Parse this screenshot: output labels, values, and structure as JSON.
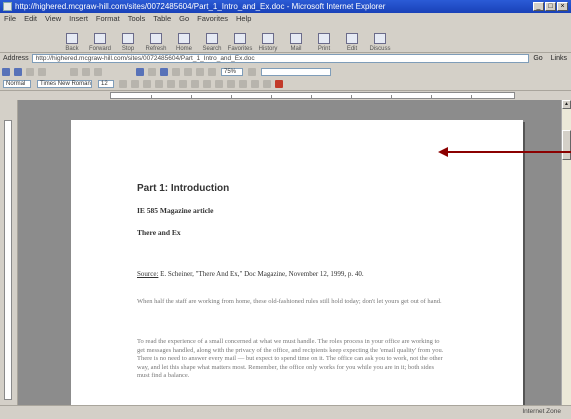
{
  "titlebar": {
    "title": "http://highered.mcgraw-hill.com/sites/0072485604/Part_1_Intro_and_Ex.doc - Microsoft Internet Explorer",
    "min": "_",
    "max": "□",
    "close": "×"
  },
  "menu": [
    "File",
    "Edit",
    "View",
    "Insert",
    "Format",
    "Tools",
    "Table",
    "Go",
    "Favorites",
    "Help"
  ],
  "toolbar": [
    {
      "label": "Back",
      "icon": "back-icon"
    },
    {
      "label": "Forward",
      "icon": "forward-icon"
    },
    {
      "label": "Stop",
      "icon": "stop-icon"
    },
    {
      "label": "Refresh",
      "icon": "refresh-icon"
    },
    {
      "label": "Home",
      "icon": "home-icon"
    },
    {
      "label": "Search",
      "icon": "search-icon"
    },
    {
      "label": "Favorites",
      "icon": "favorites-icon"
    },
    {
      "label": "History",
      "icon": "history-icon"
    },
    {
      "label": "Mail",
      "icon": "mail-icon"
    },
    {
      "label": "Print",
      "icon": "print-icon"
    },
    {
      "label": "Edit",
      "icon": "edit-icon"
    },
    {
      "label": "Discuss",
      "icon": "discuss-icon"
    }
  ],
  "address": {
    "label": "Address",
    "value": "http://highered.mcgraw-hill.com/sites/0072485604/Part_1_Intro_and_Ex.doc",
    "go": "Go",
    "links": "Links"
  },
  "format": {
    "style": "Normal",
    "font": "Times New Roman",
    "size": "12",
    "zoom": "75%"
  },
  "status": {
    "left": "",
    "right": "Internet Zone"
  },
  "document": {
    "title": "Part 1: Introduction",
    "subtitle1": "IE 585 Magazine article",
    "subtitle2": "There and Ex",
    "source_label": "Source:",
    "source_text": "E. Scheiner, \"There And Ex,\" Doc Magazine, November 12, 1999, p. 40.",
    "para1": "When half the staff are working from home, these old-fashioned rules still hold today; don't let yours get out of hand.",
    "para2": "To read the experience of a small concerned at what we must handle. The roles process in your office are working to get messages handled, along with the privacy of the office, and recipients keep expecting the 'email quality' from you. There is no need to answer every mail — but expect to spend time on it. The office can ask you to work, not the other way, and let this shape what matters most. Remember, the office only works for you while you are in it; both sides must find a balance."
  },
  "arrow_color": "#8b0000"
}
